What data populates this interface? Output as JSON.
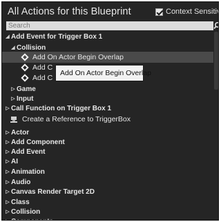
{
  "window": {
    "title": "All Actions for this Blueprint"
  },
  "context": {
    "label": "Context Sensitive",
    "checked": true
  },
  "search": {
    "placeholder": "Search"
  },
  "tooltip": {
    "text": "Add On Actor Begin Overlap"
  },
  "tree": {
    "items": [
      {
        "label": "Add Event for Trigger Box 1",
        "kind": "category-open",
        "level": 0
      },
      {
        "label": "Collision",
        "kind": "category-open",
        "level": 1
      },
      {
        "label": "Add On Actor Begin Overlap",
        "kind": "action",
        "level": 2,
        "highlighted": true
      },
      {
        "label": "Add C",
        "kind": "action",
        "level": 2
      },
      {
        "label": "Add C",
        "kind": "action",
        "level": 2
      },
      {
        "label": "Game",
        "kind": "category-closed",
        "level": 1
      },
      {
        "label": "Input",
        "kind": "category-closed",
        "level": 1
      },
      {
        "label": "Call Function on Trigger Box 1",
        "kind": "category-closed",
        "level": 0
      },
      {
        "label": "Create a Reference to TriggerBox",
        "kind": "reference",
        "level": 1
      },
      {
        "label": "",
        "kind": "spacer",
        "level": 0
      },
      {
        "label": "Actor",
        "kind": "category-closed",
        "level": 0
      },
      {
        "label": "Add Component",
        "kind": "category-closed",
        "level": 0
      },
      {
        "label": "Add Event",
        "kind": "category-closed",
        "level": 0
      },
      {
        "label": "AI",
        "kind": "category-closed",
        "level": 0
      },
      {
        "label": "Animation",
        "kind": "category-closed",
        "level": 0
      },
      {
        "label": "Audio",
        "kind": "category-closed",
        "level": 0
      },
      {
        "label": "Canvas Render Target 2D",
        "kind": "category-closed",
        "level": 0
      },
      {
        "label": "Class",
        "kind": "category-closed",
        "level": 0
      },
      {
        "label": "Collision",
        "kind": "category-closed",
        "level": 0
      },
      {
        "label": "Components",
        "kind": "category-closed",
        "level": 0
      }
    ]
  },
  "colors": {
    "panel_bg": "#252525",
    "highlight": "#4a4a4a",
    "text": "#e6e6e6",
    "search_bg": "#dcdcdc"
  }
}
